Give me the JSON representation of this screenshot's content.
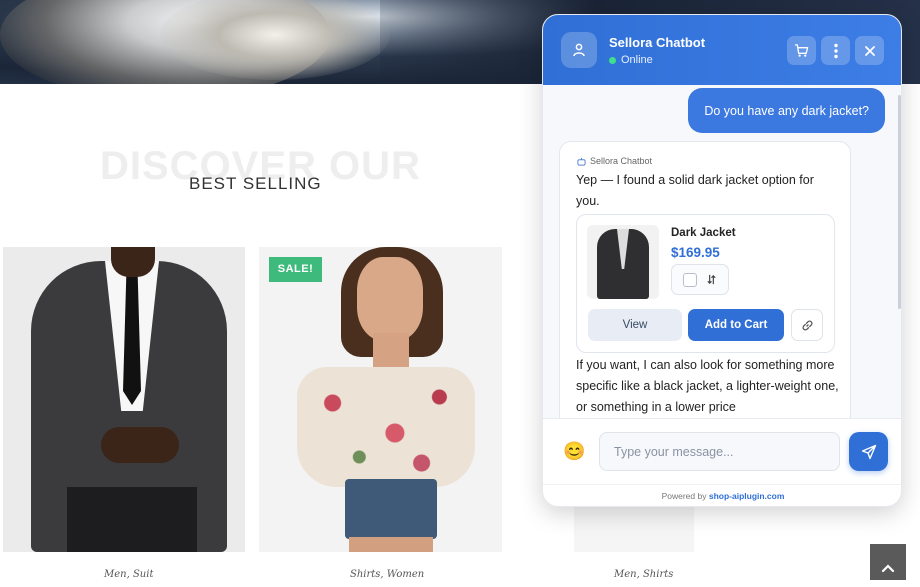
{
  "section": {
    "watermark": "DISCOVER OUR",
    "heading": "BEST SELLING"
  },
  "products": [
    {
      "categories": "Men, Suit"
    },
    {
      "categories": "Shirts, Women",
      "badge": "SALE!"
    },
    {
      "categories": "Men, Shirts"
    }
  ],
  "chat": {
    "title": "Sellora Chatbot",
    "status": "Online",
    "header_icons": [
      "cart-icon",
      "more-vertical-icon",
      "close-icon"
    ],
    "messages": {
      "user": "Do you have any dark jacket?",
      "bot_label": "Sellora Chatbot",
      "bot_intro": "Yep — I found a solid dark jacket option for you.",
      "bot_followup": "If you want, I can also look for something more specific like a black jacket, a lighter-weight one, or something in a lower price"
    },
    "product_card": {
      "name": "Dark Jacket",
      "price": "$169.95",
      "view_label": "View",
      "add_label": "Add to Cart"
    },
    "composer": {
      "emoji": "😊",
      "placeholder": "Type your message..."
    },
    "footer": {
      "prefix": "Powered by ",
      "brand": "shop-aiplugin.com"
    },
    "colors": {
      "accent": "#2f6fd6",
      "online": "#3ee08a",
      "sale": "#3dba7c"
    }
  }
}
